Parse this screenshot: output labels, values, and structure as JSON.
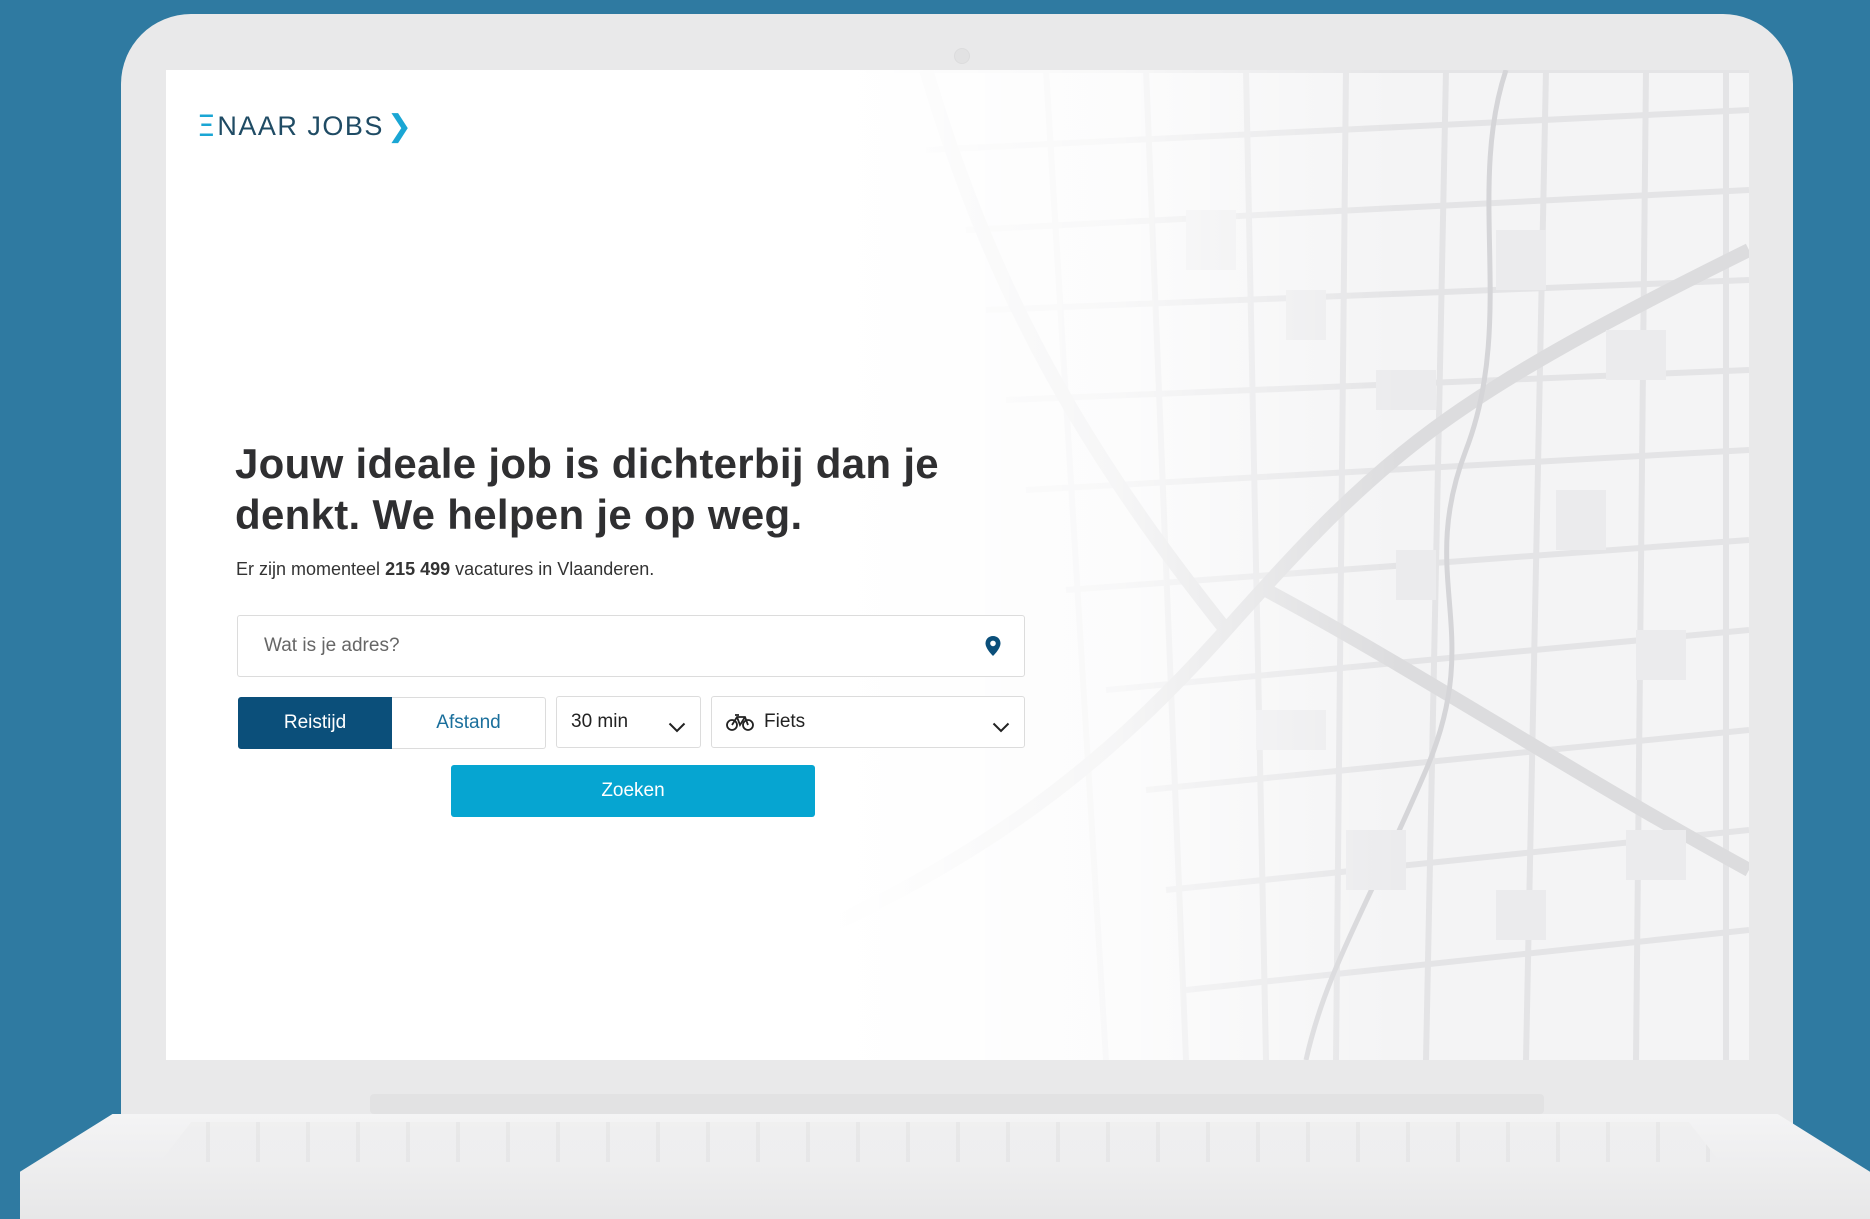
{
  "brand": {
    "logo_mark": "Ξ",
    "logo_text": "NAAR JOBS",
    "logo_chevron": "❯",
    "accent_color": "#1aa6d4",
    "dark_color": "#1f4b64"
  },
  "hero": {
    "headline": "Jouw ideale job is dichterbij dan je denkt. We helpen je op weg.",
    "subline_prefix": "Er zijn momenteel",
    "vacancy_count": "215 499",
    "subline_suffix": "vacatures in Vlaanderen."
  },
  "search": {
    "address_placeholder": "Wat is je adres?",
    "address_value": "",
    "pin_icon": "location-pin-icon",
    "toggle": {
      "options": [
        "Reistijd",
        "Afstand"
      ],
      "selected": "Reistijd"
    },
    "time_select": {
      "value": "30 min",
      "icon": "chevron-down-icon"
    },
    "mode_select": {
      "value": "Fiets",
      "icon": "bicycle-icon"
    },
    "submit_label": "Zoeken"
  },
  "colors": {
    "background": "#2f7aa1",
    "toggle_active": "#0b4f7a",
    "button": "#06a5d1"
  }
}
